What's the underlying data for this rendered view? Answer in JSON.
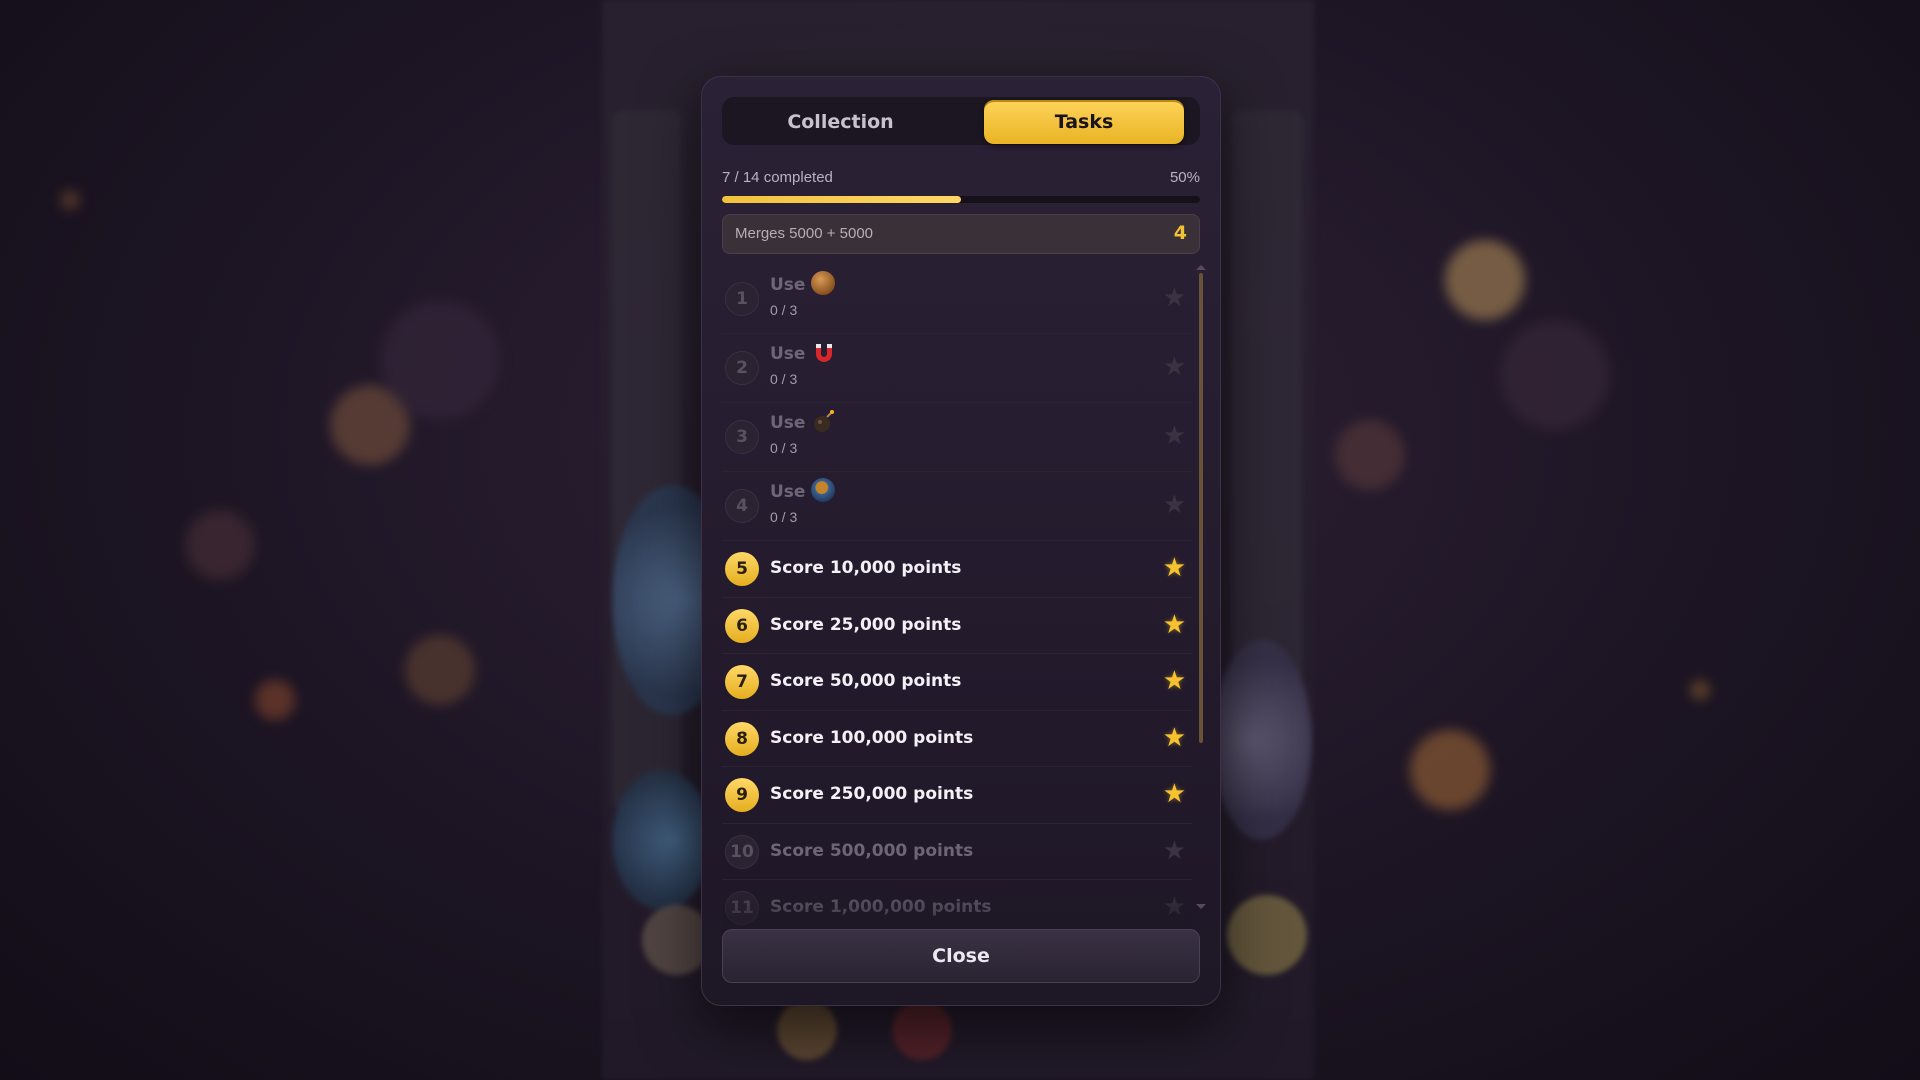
{
  "tabs": [
    {
      "label": "Collection",
      "active": false
    },
    {
      "label": "Tasks",
      "active": true
    }
  ],
  "progress": {
    "completed_text": "7 / 14 completed",
    "percent_text": "50%",
    "fraction": 0.5
  },
  "merges": {
    "label": "Merges 5000 + 5000",
    "count": "4"
  },
  "tasks": [
    {
      "number": "1",
      "title": "Use",
      "icon": "brown-coin-icon",
      "progress": "0 / 3",
      "done": false
    },
    {
      "number": "2",
      "title": "Use",
      "icon": "magnet-icon",
      "progress": "0 / 3",
      "done": false
    },
    {
      "number": "3",
      "title": "Use",
      "icon": "bomb-icon",
      "progress": "0 / 3",
      "done": false
    },
    {
      "number": "4",
      "title": "Use",
      "icon": "blue-orb-icon",
      "progress": "0 / 3",
      "done": false
    },
    {
      "number": "5",
      "title": "Score 10,000 points",
      "done": true
    },
    {
      "number": "6",
      "title": "Score 25,000 points",
      "done": true
    },
    {
      "number": "7",
      "title": "Score 50,000 points",
      "done": true
    },
    {
      "number": "8",
      "title": "Score 100,000 points",
      "done": true
    },
    {
      "number": "9",
      "title": "Score 250,000 points",
      "done": true
    },
    {
      "number": "10",
      "title": "Score 500,000 points",
      "done": false
    },
    {
      "number": "11",
      "title": "Score 1,000,000 points",
      "done": false
    }
  ],
  "close_label": "Close",
  "colors": {
    "accent": "#f2c236",
    "panel": "#241c2d",
    "star_off": "#3b3342"
  }
}
